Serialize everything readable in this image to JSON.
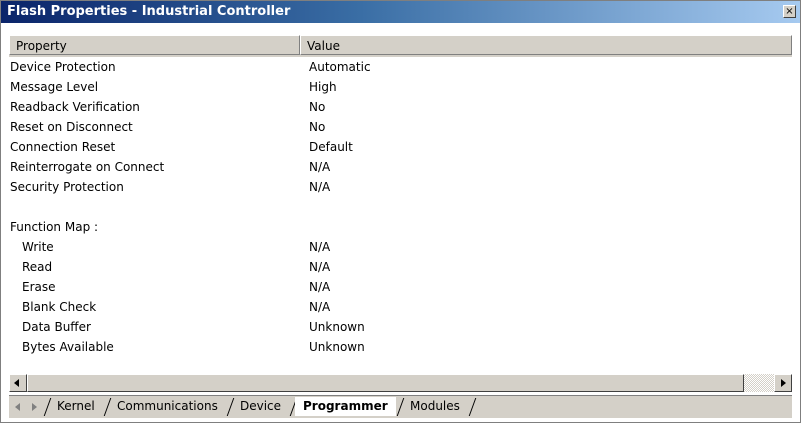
{
  "window": {
    "title": "Flash Properties - Industrial Controller",
    "close_glyph": "×"
  },
  "columns": {
    "property": "Property",
    "value": "Value"
  },
  "rows": [
    {
      "property": "Device Protection",
      "value": "Automatic"
    },
    {
      "property": "Message Level",
      "value": "High"
    },
    {
      "property": "Readback Verification",
      "value": "No"
    },
    {
      "property": "Reset on Disconnect",
      "value": "No"
    },
    {
      "property": "Connection Reset",
      "value": "Default"
    },
    {
      "property": "Reinterrogate on Connect",
      "value": "N/A"
    },
    {
      "property": "Security Protection",
      "value": "N/A"
    },
    {
      "property": "",
      "value": ""
    },
    {
      "property": "Function Map :",
      "value": ""
    },
    {
      "property": "Write",
      "value": "N/A",
      "indent": true
    },
    {
      "property": "Read",
      "value": "N/A",
      "indent": true
    },
    {
      "property": "Erase",
      "value": "N/A",
      "indent": true
    },
    {
      "property": "Blank Check",
      "value": "N/A",
      "indent": true
    },
    {
      "property": "Data Buffer",
      "value": "Unknown",
      "indent": true
    },
    {
      "property": "Bytes Available",
      "value": "Unknown",
      "indent": true
    }
  ],
  "tabs": [
    {
      "label": "Kernel",
      "active": false
    },
    {
      "label": "Communications",
      "active": false
    },
    {
      "label": "Device",
      "active": false
    },
    {
      "label": "Programmer",
      "active": true
    },
    {
      "label": "Modules",
      "active": false
    }
  ]
}
